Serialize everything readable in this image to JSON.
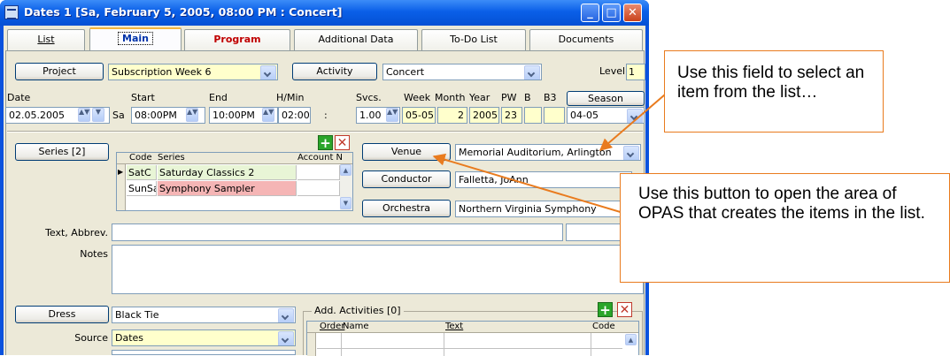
{
  "window": {
    "title": "Dates  1 [Sa, February  5, 2005, 08:00 PM : Concert]"
  },
  "tabs": [
    {
      "label": "List"
    },
    {
      "label": "Main"
    },
    {
      "label": "Program"
    },
    {
      "label": "Additional Data"
    },
    {
      "label": "To-Do List"
    },
    {
      "label": "Documents"
    }
  ],
  "row1": {
    "project_btn": "Project",
    "project_value": "Subscription Week 6",
    "activity_btn": "Activity",
    "activity_value": "Concert",
    "level_label": "Level",
    "level_value": "1"
  },
  "date_row": {
    "headers": {
      "date": "Date",
      "start": "Start",
      "end": "End",
      "hmin": "H/Min",
      "svcs": "Svcs.",
      "week": "Week",
      "month": "Month",
      "year": "Year",
      "pw": "PW",
      "b": "B",
      "b3": "B3"
    },
    "season_btn": "Season",
    "date": "02.05.2005",
    "day": "Sa",
    "start": "08:00PM",
    "end": "10:00PM",
    "hmin": "02:00",
    "colon": ":",
    "svcs": "1.00",
    "week": "05-05",
    "month": "2",
    "year": "2005",
    "pw": "23",
    "season": "04-05"
  },
  "series": {
    "btn": "Series [2]",
    "columns": [
      "Code",
      "Series",
      "Account N"
    ],
    "rows": [
      {
        "code": "SatC",
        "series": "Saturday Classics 2"
      },
      {
        "code": "SunSa",
        "series": "Symphony Sampler"
      }
    ]
  },
  "venue": {
    "btn": "Venue",
    "value": "Memorial Auditorium, Arlington"
  },
  "conductor": {
    "btn": "Conductor",
    "value": "Falletta, JoAnn"
  },
  "orchestra": {
    "btn": "Orchestra",
    "value": "Northern Virginia Symphony"
  },
  "text_abbrev_label": "Text, Abbrev.",
  "notes_label": "Notes",
  "dress": {
    "btn": "Dress",
    "value": "Black Tie"
  },
  "source": {
    "label": "Source",
    "value": "Dates"
  },
  "add_activities": {
    "title": "Add. Activities [0]",
    "columns": [
      "Order",
      "Name",
      "Text",
      "Code"
    ]
  },
  "callouts": {
    "field": "Use this field to select an item from the list…",
    "button": "Use this button to open the area of OPAS that creates the items in the list."
  },
  "colors": {
    "accent_orange": "#E97B1E",
    "xp_blue": "#0A52DE",
    "yellow_field": "#FFFFCC",
    "green_row": "#E8F5D6",
    "pink_row": "#F5B5B5"
  }
}
